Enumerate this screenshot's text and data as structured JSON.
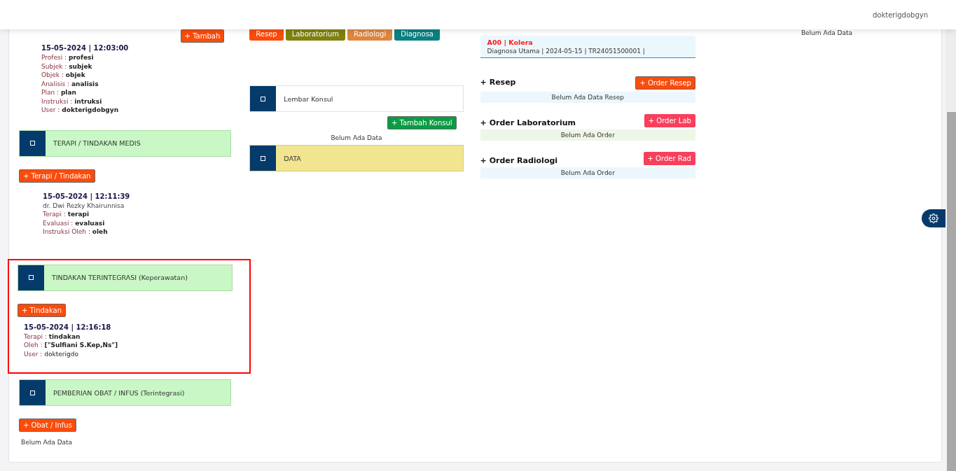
{
  "header": {
    "user": "dokterigdobgyn"
  },
  "column_1": {
    "add_button": "+ Tambah",
    "soap_entry": {
      "date": "15-05-2024 | 12:03:00",
      "lines": [
        {
          "label": "Profesi :",
          "value": "profesi",
          "bold": true
        },
        {
          "label": "Subjek :",
          "value": "subjek",
          "bold": true
        },
        {
          "label": "Objek :",
          "value": "objek",
          "bold": true
        },
        {
          "label": "Analisis :",
          "value": "analisis",
          "bold": true
        },
        {
          "label": "Plan :",
          "value": "plan",
          "bold": true
        },
        {
          "label": "Instruksi :",
          "value": "intruksi",
          "bold": true
        },
        {
          "label": "User :",
          "value": "dokterigdobgyn",
          "bold": true
        }
      ]
    },
    "sections": [
      {
        "title": "TERAPI / TINDAKAN MEDIS",
        "color": "#c9f7c5",
        "highlighted": false,
        "button": "+ Terapi / Tindakan",
        "entry": {
          "date": "15-05-2024 | 12:11:39",
          "doctor": "dr. Dwi Rezky Khairunnisa",
          "lines": [
            {
              "label": "Terapi :",
              "value": "terapi",
              "bold": true
            },
            {
              "label": "Evaluasi :",
              "value": "evaluasi",
              "bold": true
            },
            {
              "label": "Instruksi Oleh :",
              "value": "oleh",
              "bold": true
            }
          ]
        }
      },
      {
        "title": "TINDAKAN TERINTEGRASI (Keperawatan)",
        "color": "#c9f7c5",
        "highlighted": true,
        "button": "+ Tindakan",
        "entry": {
          "date": "15-05-2024 | 12:16:18",
          "lines": [
            {
              "label": "Terapi :",
              "value": "tindakan",
              "bold": true
            },
            {
              "label": "Oleh :",
              "value": "[\"Sulfiani S.Kep,Ns\"]",
              "bold": true
            },
            {
              "label": "User :",
              "value": "dokterigdo",
              "bold": false
            }
          ]
        }
      },
      {
        "title": "PEMBERIAN OBAT / INFUS (Terintegrasi)",
        "color": "#c9f7c5",
        "highlighted": false,
        "button": "+ Obat / Infus",
        "empty": "Belum Ada Data"
      }
    ]
  },
  "column_2": {
    "tabs": [
      {
        "label": "Resep",
        "color": "#fc4b0b"
      },
      {
        "label": "Laboratorium",
        "color": "#808010"
      },
      {
        "label": "Radiologi",
        "color": "#dc8640"
      },
      {
        "label": "Diagnosa",
        "color": "#0a8080"
      }
    ],
    "sections": [
      {
        "title": "Lembar Konsul",
        "color": "#ffffff",
        "button": "+ Tambah Konsul",
        "empty": "Belum Ada Data"
      },
      {
        "title": "DATA",
        "color": "#f2e58f"
      }
    ]
  },
  "column_3": {
    "diagnosis": {
      "code": "A00 | Kolera",
      "detail": "Diagnosa Utama | 2024-05-15 | TR24051500001 |"
    },
    "orders": [
      {
        "title": "+ Resep",
        "button": {
          "label": "+ Order Resep",
          "color": "#fc4b0b"
        },
        "bar": {
          "text": "Belum Ada Data Resep",
          "color": "#ecf7fd"
        }
      },
      {
        "title": "+ Order Laboratorium",
        "button": {
          "label": "+ Order Lab",
          "color": "#f83f5c"
        },
        "bar": {
          "text": "Belum Ada Order",
          "color": "#eef6e8"
        }
      },
      {
        "title": "+ Order Radiologi",
        "button": {
          "label": "+ Order Rad",
          "color": "#f83f5c"
        },
        "bar": {
          "text": "Belum Ada Order",
          "color": "#ecf7fd"
        }
      }
    ]
  },
  "column_4": {
    "empty": "Belum Ada Data"
  }
}
